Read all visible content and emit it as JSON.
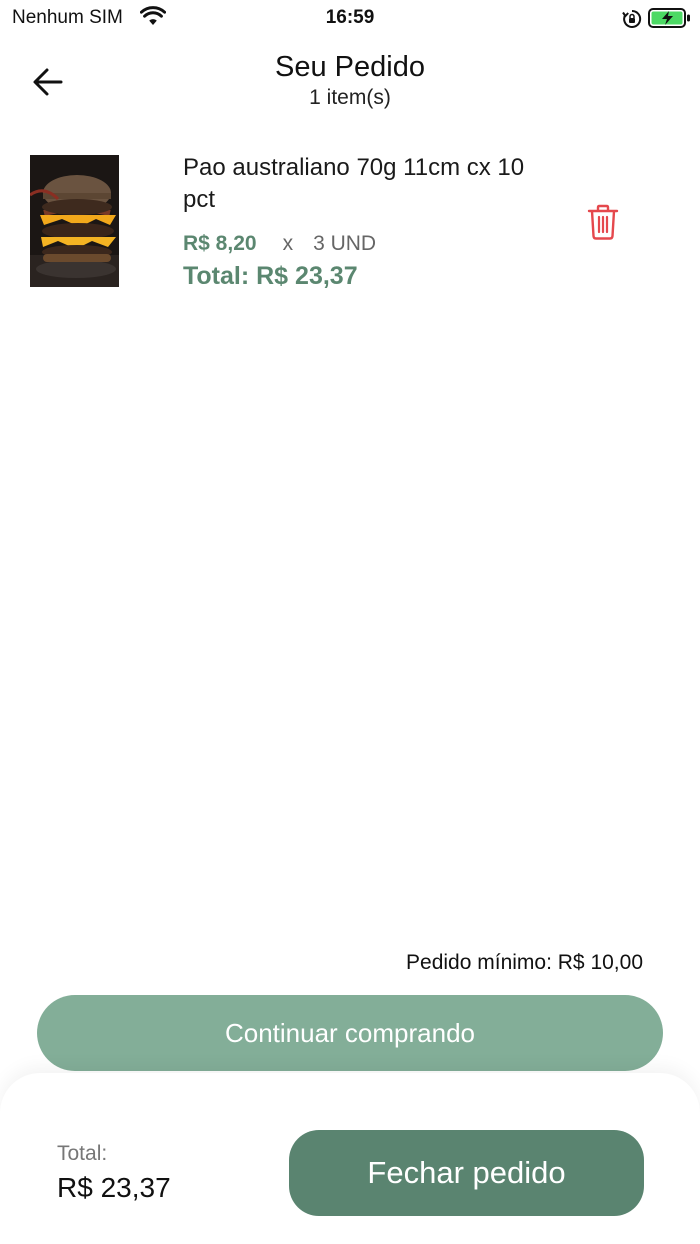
{
  "status_bar": {
    "carrier": "Nenhum SIM",
    "time": "16:59",
    "icons": [
      "wifi-icon",
      "rotation-lock-icon",
      "battery-charging-icon"
    ]
  },
  "header": {
    "title": "Seu Pedido",
    "subtitle": "1 item(s)",
    "back_icon": "arrow-left-icon"
  },
  "cart": {
    "items": [
      {
        "name": "Pao australiano 70g 11cm cx 10 pct",
        "unit_price": "R$ 8,20",
        "times": "x",
        "quantity": "3 UND",
        "total": "Total: R$ 23,37",
        "image": "burger-photo",
        "delete_icon": "trash-icon"
      }
    ]
  },
  "min_order": "Pedido mínimo: R$ 10,00",
  "continue_label": "Continuar comprando",
  "footer": {
    "total_label": "Total:",
    "total_value": "R$ 23,37",
    "checkout_label": "Fechar pedido"
  },
  "colors": {
    "accent_green": "#5b8770",
    "continue_button": "#83ae98",
    "checkout_button": "#5a8470",
    "delete_red": "#e5484d",
    "battery_green": "#4cd964"
  }
}
